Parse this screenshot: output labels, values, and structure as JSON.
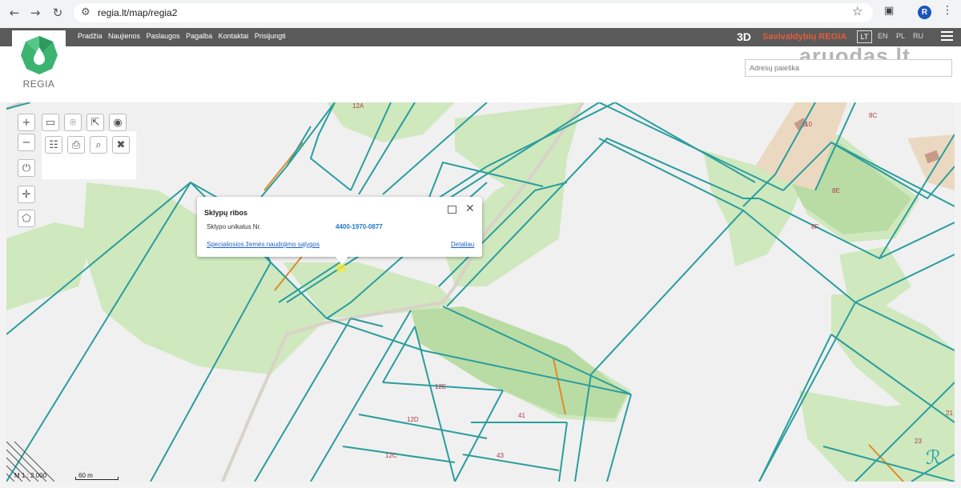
{
  "browser": {
    "url": "regia.lt/map/regia2",
    "profile_initial": "R"
  },
  "site": {
    "nav": [
      "Pradžia",
      "Naujienos",
      "Paslaugos",
      "Pagalba",
      "Kontaktai",
      "Prisijungti"
    ],
    "btn_3d": "3D",
    "brand": "Savivaldybių REGIA",
    "languages": [
      "LT",
      "EN",
      "PL",
      "RU"
    ],
    "logo_text": "REGIA",
    "watermark": "aruodas.lt",
    "search_placeholder": "Adresų paieška"
  },
  "popup": {
    "title": "Sklypų ribos",
    "field_label": "Sklypo unikalus Nr.",
    "field_value": "4400-1970-0877",
    "link_special": "Specialiosios žemės naudojimo sąlygos",
    "link_details": "Detaliau"
  },
  "map": {
    "plot_labels": [
      "12A",
      "10",
      "8C",
      "8E",
      "8F",
      "12E",
      "12D",
      "12C",
      "41",
      "43",
      "23",
      "21"
    ],
    "scale_ratio": "M 1 : 2 000",
    "scale_distance": "60 m"
  },
  "colors": {
    "boundary": "#2a9d9d",
    "vegetation": "#cfe8be",
    "forest_dark": "#b9dca4",
    "header": "#5a5a5a",
    "brand": "#e35c3b",
    "link": "#1f62c4"
  }
}
